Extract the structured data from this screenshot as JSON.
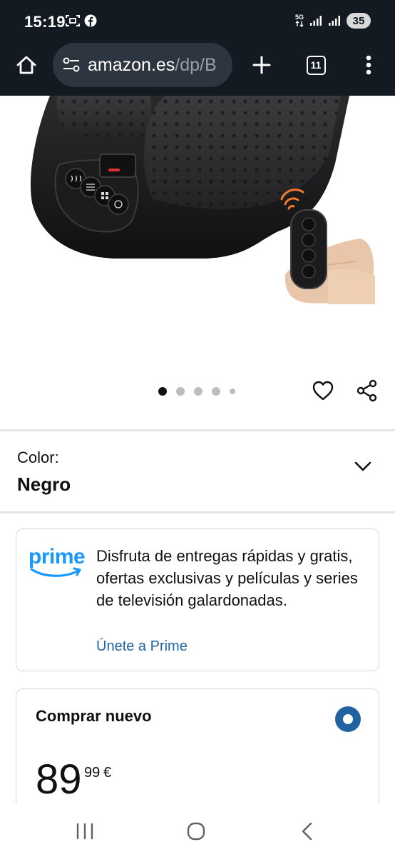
{
  "status_bar": {
    "time": "15:19",
    "network": "5G",
    "battery": "35"
  },
  "browser": {
    "url_host": "amazon.es",
    "url_path": "/dp/B",
    "tab_count": "11"
  },
  "product": {
    "image_alt": "foot-massager-with-remote",
    "carousel": {
      "total": 5,
      "active_index": 0
    }
  },
  "color_selector": {
    "label": "Color:",
    "value": "Negro"
  },
  "prime": {
    "logo_text": "prime",
    "description": "Disfruta de entregas rápidas y gratis, ofertas exclusivas y películas y series de televisión galardonadas.",
    "link": "Únete a Prime"
  },
  "buy_box": {
    "title": "Comprar nuevo",
    "price_whole": "89",
    "price_fraction": "99",
    "currency": "€"
  },
  "colors": {
    "chrome": "#131a22",
    "prime_blue": "#1a98ff",
    "link": "#2162a1"
  }
}
